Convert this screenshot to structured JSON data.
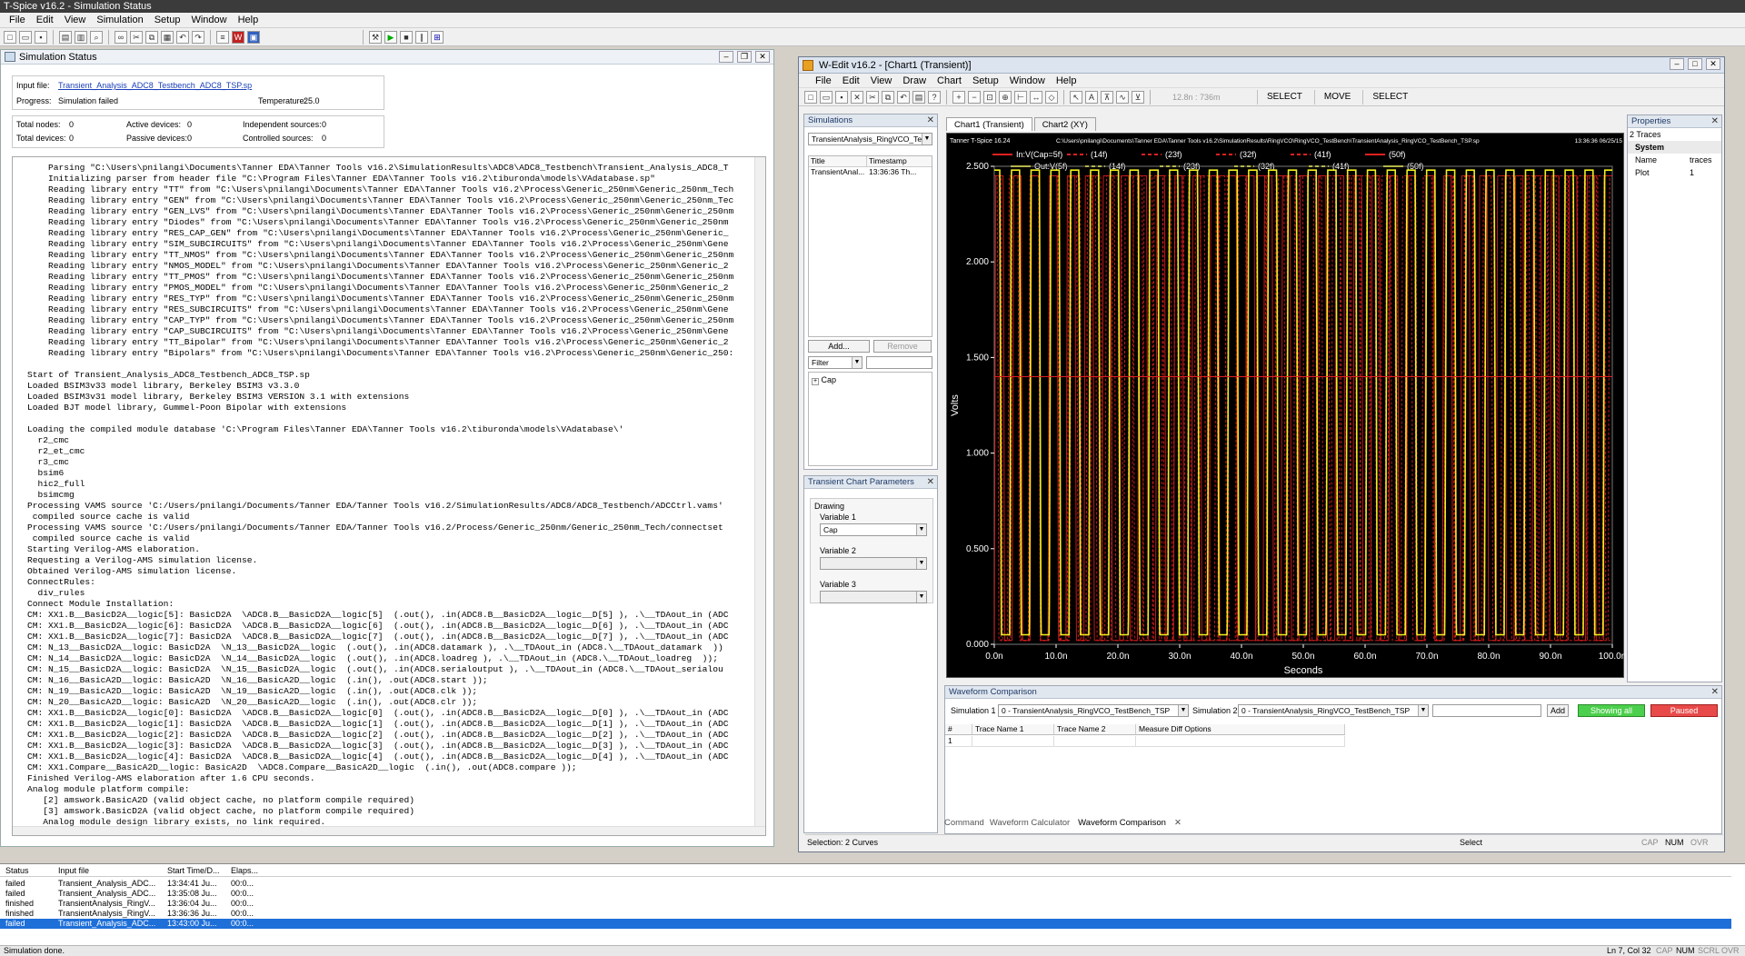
{
  "app": {
    "title": "T-Spice v16.2 - Simulation Status",
    "menus": [
      "File",
      "Edit",
      "View",
      "Simulation",
      "Setup",
      "Window",
      "Help"
    ]
  },
  "status_window": {
    "title": "Simulation Status",
    "input_file_label": "Input file:",
    "input_file": "Transient_Analysis_ADC8_Testbench_ADC8_TSP.sp",
    "progress_label": "Progress:",
    "progress": "Simulation failed",
    "temperature_label": "Temperature:",
    "temperature": "25.0",
    "counts": [
      {
        "label": "Total nodes:",
        "value": "0"
      },
      {
        "label": "Active devices:",
        "value": "0"
      },
      {
        "label": "Independent sources:",
        "value": "0"
      },
      {
        "label": "Total devices:",
        "value": "0"
      },
      {
        "label": "Passive devices:",
        "value": "0"
      },
      {
        "label": "Controlled sources:",
        "value": "0"
      }
    ],
    "log": "    Parsing \"C:\\Users\\pnilangi\\Documents\\Tanner EDA\\Tanner Tools v16.2\\SimulationResults\\ADC8\\ADC8_Testbench\\Transient_Analysis_ADC8_T\n    Initializing parser from header file \"C:\\Program Files\\Tanner EDA\\Tanner Tools v16.2\\tiburonda\\models\\VAdatabase.sp\"\n    Reading library entry \"TT\" from \"C:\\Users\\pnilangi\\Documents\\Tanner EDA\\Tanner Tools v16.2\\Process\\Generic_250nm\\Generic_250nm_Tech\n    Reading library entry \"GEN\" from \"C:\\Users\\pnilangi\\Documents\\Tanner EDA\\Tanner Tools v16.2\\Process\\Generic_250nm\\Generic_250nm_Tec\n    Reading library entry \"GEN_LVS\" from \"C:\\Users\\pnilangi\\Documents\\Tanner EDA\\Tanner Tools v16.2\\Process\\Generic_250nm\\Generic_250nm\n    Reading library entry \"Diodes\" from \"C:\\Users\\pnilangi\\Documents\\Tanner EDA\\Tanner Tools v16.2\\Process\\Generic_250nm\\Generic_250nm\n    Reading library entry \"RES_CAP_GEN\" from \"C:\\Users\\pnilangi\\Documents\\Tanner EDA\\Tanner Tools v16.2\\Process\\Generic_250nm\\Generic_\n    Reading library entry \"SIM_SUBCIRCUITS\" from \"C:\\Users\\pnilangi\\Documents\\Tanner EDA\\Tanner Tools v16.2\\Process\\Generic_250nm\\Gene\n    Reading library entry \"TT_NMOS\" from \"C:\\Users\\pnilangi\\Documents\\Tanner EDA\\Tanner Tools v16.2\\Process\\Generic_250nm\\Generic_250nm\n    Reading library entry \"NMOS_MODEL\" from \"C:\\Users\\pnilangi\\Documents\\Tanner EDA\\Tanner Tools v16.2\\Process\\Generic_250nm\\Generic_2\n    Reading library entry \"TT_PMOS\" from \"C:\\Users\\pnilangi\\Documents\\Tanner EDA\\Tanner Tools v16.2\\Process\\Generic_250nm\\Generic_250nm\n    Reading library entry \"PMOS_MODEL\" from \"C:\\Users\\pnilangi\\Documents\\Tanner EDA\\Tanner Tools v16.2\\Process\\Generic_250nm\\Generic_2\n    Reading library entry \"RES_TYP\" from \"C:\\Users\\pnilangi\\Documents\\Tanner EDA\\Tanner Tools v16.2\\Process\\Generic_250nm\\Generic_250nm\n    Reading library entry \"RES_SUBCIRCUITS\" from \"C:\\Users\\pnilangi\\Documents\\Tanner EDA\\Tanner Tools v16.2\\Process\\Generic_250nm\\Gene\n    Reading library entry \"CAP_TYP\" from \"C:\\Users\\pnilangi\\Documents\\Tanner EDA\\Tanner Tools v16.2\\Process\\Generic_250nm\\Generic_250nm\n    Reading library entry \"CAP_SUBCIRCUITS\" from \"C:\\Users\\pnilangi\\Documents\\Tanner EDA\\Tanner Tools v16.2\\Process\\Generic_250nm\\Gene\n    Reading library entry \"TT_Bipolar\" from \"C:\\Users\\pnilangi\\Documents\\Tanner EDA\\Tanner Tools v16.2\\Process\\Generic_250nm\\Generic_2\n    Reading library entry \"Bipolars\" from \"C:\\Users\\pnilangi\\Documents\\Tanner EDA\\Tanner Tools v16.2\\Process\\Generic_250nm\\Generic_250:\n\nStart of Transient_Analysis_ADC8_Testbench_ADC8_TSP.sp\nLoaded BSIM3v33 model library, Berkeley BSIM3 v3.3.0\nLoaded BSIM3v31 model library, Berkeley BSIM3 VERSION 3.1 with extensions\nLoaded BJT model library, Gummel-Poon Bipolar with extensions\n\nLoading the compiled module database 'C:\\Program Files\\Tanner EDA\\Tanner Tools v16.2\\tiburonda\\models\\VAdatabase\\'\n  r2_cmc\n  r2_et_cmc\n  r3_cmc\n  bsim6\n  hic2_full\n  bsimcmg\nProcessing VAMS source 'C:/Users/pnilangi/Documents/Tanner EDA/Tanner Tools v16.2/SimulationResults/ADC8/ADC8_Testbench/ADCCtrl.vams'\n compiled source cache is valid\nProcessing VAMS source 'C:/Users/pnilangi/Documents/Tanner EDA/Tanner Tools v16.2/Process/Generic_250nm/Generic_250nm_Tech/connectset\n compiled source cache is valid\nStarting Verilog-AMS elaboration.\nRequesting a Verilog-AMS simulation license.\nObtained Verilog-AMS simulation license.\nConnectRules:\n  div_rules\nConnect Module Installation:\nCM: XX1.B__BasicD2A__logic[5]: BasicD2A  \\ADC8.B__BasicD2A__logic[5]  (.out(), .in(ADC8.B__BasicD2A__logic__D[5] ), .\\__TDAout_in (ADC\nCM: XX1.B__BasicD2A__logic[6]: BasicD2A  \\ADC8.B__BasicD2A__logic[6]  (.out(), .in(ADC8.B__BasicD2A__logic__D[6] ), .\\__TDAout_in (ADC\nCM: XX1.B__BasicD2A__logic[7]: BasicD2A  \\ADC8.B__BasicD2A__logic[7]  (.out(), .in(ADC8.B__BasicD2A__logic__D[7] ), .\\__TDAout_in (ADC\nCM: N_13__BasicD2A__logic: BasicD2A  \\N_13__BasicD2A__logic  (.out(), .in(ADC8.datamark ), .\\__TDAout_in (ADC8.\\__TDAout_datamark  ))\nCM: N_14__BasicD2A__logic: BasicD2A  \\N_14__BasicD2A__logic  (.out(), .in(ADC8.loadreg ), .\\__TDAout_in (ADC8.\\__TDAout_loadreg  ));\nCM: N_15__BasicD2A__logic: BasicD2A  \\N_15__BasicD2A__logic  (.out(), .in(ADC8.serialoutput ), .\\__TDAout_in (ADC8.\\__TDAout_serialou\nCM: N_16__BasicA2D__logic: BasicA2D  \\N_16__BasicA2D__logic  (.in(), .out(ADC8.start ));\nCM: N_19__BasicA2D__logic: BasicA2D  \\N_19__BasicA2D__logic  (.in(), .out(ADC8.clk ));\nCM: N_20__BasicA2D__logic: BasicA2D  \\N_20__BasicA2D__logic  (.in(), .out(ADC8.clr ));\nCM: XX1.B__BasicD2A__logic[0]: BasicD2A  \\ADC8.B__BasicD2A__logic[0]  (.out(), .in(ADC8.B__BasicD2A__logic__D[0] ), .\\__TDAout_in (ADC\nCM: XX1.B__BasicD2A__logic[1]: BasicD2A  \\ADC8.B__BasicD2A__logic[1]  (.out(), .in(ADC8.B__BasicD2A__logic__D[1] ), .\\__TDAout_in (ADC\nCM: XX1.B__BasicD2A__logic[2]: BasicD2A  \\ADC8.B__BasicD2A__logic[2]  (.out(), .in(ADC8.B__BasicD2A__logic__D[2] ), .\\__TDAout_in (ADC\nCM: XX1.B__BasicD2A__logic[3]: BasicD2A  \\ADC8.B__BasicD2A__logic[3]  (.out(), .in(ADC8.B__BasicD2A__logic__D[3] ), .\\__TDAout_in (ADC\nCM: XX1.B__BasicD2A__logic[4]: BasicD2A  \\ADC8.B__BasicD2A__logic[4]  (.out(), .in(ADC8.B__BasicD2A__logic__D[4] ), .\\__TDAout_in (ADC\nCM: XX1.Compare__BasicA2D__logic: BasicA2D  \\ADC8.Compare__BasicA2D__logic  (.in(), .out(ADC8.compare ));\nFinished Verilog-AMS elaboration after 1.6 CPU seconds.\nAnalog module platform compile:\n   [2] amswork.BasicA2D (valid object cache, no platform compile required)\n   [3] amswork.BasicD2A (valid object cache, no platform compile required)\n   Analog module design library exists, no link required."
  },
  "wedit": {
    "title": "W-Edit v16.2 - [Chart1 (Transient)]",
    "menus": [
      "File",
      "Edit",
      "View",
      "Draw",
      "Chart",
      "Setup",
      "Window",
      "Help"
    ],
    "coord_readout": "12.8n : 736m",
    "mode_buttons": [
      "SELECT",
      "MOVE",
      "SELECT"
    ],
    "simulations_panel": {
      "title": "Simulations",
      "selected": "TransientAnalysis_RingVCO_TestB",
      "columns": [
        "Title",
        "Timestamp"
      ],
      "rows": [
        [
          "TransientAnal...",
          "13:36:36 Th..."
        ]
      ],
      "add": "Add...",
      "remove": "Remove",
      "filter": "Filter",
      "tree_item": "Cap"
    },
    "chart_params": {
      "title": "Transient Chart Parameters",
      "group": "Drawing",
      "var1_label": "Variable 1",
      "var1": "Cap",
      "var2_label": "Variable 2",
      "var3_label": "Variable 3"
    },
    "tabs": [
      "Chart1 (Transient)",
      "Chart2 (XY)"
    ],
    "properties": {
      "title": "Properties",
      "traces": "2 Traces",
      "group": "System",
      "rows": [
        [
          "Name",
          "traces"
        ],
        [
          "Plot",
          "1"
        ]
      ]
    },
    "waveform_comparison": {
      "title": "Waveform Comparison",
      "sim1_label": "Simulation 1",
      "sim1": "0 - TransientAnalysis_RingVCO_TestBench_TSP",
      "sim2_label": "Simulation 2",
      "sim2": "0 - TransientAnalysis_RingVCO_TestBench_TSP",
      "add": "Add",
      "showing": "Showing all",
      "paused": "Paused",
      "columns": [
        "#",
        "Trace Name 1",
        "Trace Name 2",
        "Measure Diff Options"
      ],
      "rows": [
        [
          "1",
          "",
          "",
          ""
        ]
      ]
    },
    "bottom_tabs": [
      "Command",
      "Waveform Calculator",
      "Waveform Comparison"
    ],
    "status_left": "Selection: 2 Curves",
    "status_mid": "Select",
    "status_right": [
      "CAP",
      "NUM",
      "OVR"
    ]
  },
  "chart_data": {
    "type": "line",
    "header_left": "Tanner T-Spice 16.24",
    "header_path": "C:\\Users\\pnilangi\\Documents\\Tanner EDA\\Tanner Tools v16.2\\SimulationResults\\RingVCO\\RingVCO_TestBench\\TransientAnalysis_RingVCO_TestBench_TSP.sp",
    "header_right": "13:36:36 06/25/15",
    "xlabel": "Seconds",
    "ylabel": "Volts",
    "xticks": [
      "0.0n",
      "10.0n",
      "20.0n",
      "30.0n",
      "40.0n",
      "50.0n",
      "60.0n",
      "70.0n",
      "80.0n",
      "90.0n",
      "100.0n"
    ],
    "yticks": [
      "0.000",
      "0.500",
      "1.000",
      "1.500",
      "2.000",
      "2.500"
    ],
    "xlim": [
      0,
      100
    ],
    "ylim": [
      0,
      2.5
    ],
    "legend": [
      "In:V(Cap=5f)",
      "(14f)",
      "(23f)",
      "(32f)",
      "(41f)",
      "(50f)",
      "Out:V(5f)",
      "(14f)",
      "(23f)",
      "(32f)",
      "(41f)",
      "(50f)"
    ],
    "series": [
      {
        "name": "In:V(Cap=5f)",
        "color": "#e02020",
        "style": "solid",
        "period_ns": 2.9,
        "dc": 1.4,
        "amplitude": 2.5
      },
      {
        "name": "Out:V(5f)",
        "color": "#f0f020",
        "style": "solid",
        "period_ns": 3.2,
        "amplitude": 2.5
      }
    ],
    "colors": {
      "bg": "#000000",
      "in": "#e02020",
      "out": "#f0f020",
      "axis": "#ffffff"
    }
  },
  "bottom_list": {
    "columns": [
      "Status",
      "Input file",
      "Start Time/D...",
      "Elaps..."
    ],
    "rows": [
      [
        "failed",
        "Transient_Analysis_ADC...",
        "13:34:41 Ju...",
        "00:0..."
      ],
      [
        "failed",
        "Transient_Analysis_ADC...",
        "13:35:08 Ju...",
        "00:0..."
      ],
      [
        "finished",
        "TransientAnalysis_RingV...",
        "13:36:04 Ju...",
        "00:0..."
      ],
      [
        "finished",
        "TransientAnalysis_RingV...",
        "13:36:36 Ju...",
        "00:0..."
      ],
      [
        "failed",
        "Transient_Analysis_ADC...",
        "13:43:00 Ju...",
        "00:0..."
      ]
    ]
  },
  "statusbar": {
    "left": "Simulation done.",
    "pos": "Ln 7, Col 32",
    "ind": [
      "CAP",
      "NUM",
      "SCRL",
      "OVR"
    ]
  }
}
